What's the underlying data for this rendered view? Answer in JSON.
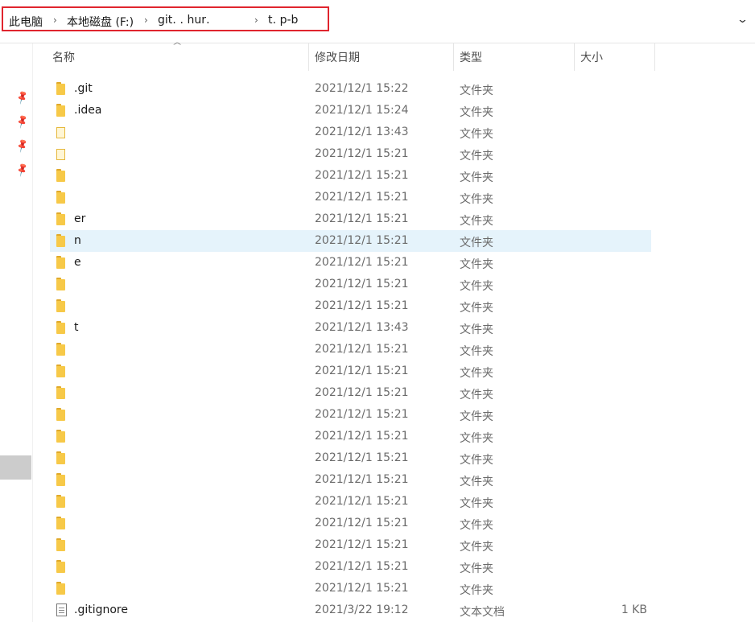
{
  "address_bar": {
    "crumbs": [
      "此电脑",
      "本地磁盘 (F:)",
      "git․ ․ hur․",
      "t․ p-b"
    ],
    "dropdown_icon": "chevron-down-icon",
    "highlight_color": "#e0252e"
  },
  "columns": {
    "name": "名称",
    "modified": "修改日期",
    "type": "类型",
    "size": "大小"
  },
  "files": [
    {
      "name": ".git",
      "modified": "2021/12/1 15:22",
      "type": "文件夹",
      "size": "",
      "icon": "folder-icon"
    },
    {
      "name": ".idea",
      "modified": "2021/12/1 15:24",
      "type": "文件夹",
      "size": "",
      "icon": "folder-icon"
    },
    {
      "name": "",
      "modified": "2021/12/1 13:43",
      "type": "文件夹",
      "size": "",
      "icon": "folder-open-icon"
    },
    {
      "name": "",
      "modified": "2021/12/1 15:21",
      "type": "文件夹",
      "size": "",
      "icon": "folder-open-icon"
    },
    {
      "name": "",
      "modified": "2021/12/1 15:21",
      "type": "文件夹",
      "size": "",
      "icon": "folder-icon"
    },
    {
      "name": "",
      "modified": "2021/12/1 15:21",
      "type": "文件夹",
      "size": "",
      "icon": "folder-icon"
    },
    {
      "name": "er",
      "modified": "2021/12/1 15:21",
      "type": "文件夹",
      "size": "",
      "icon": "folder-icon"
    },
    {
      "name": "n",
      "modified": "2021/12/1 15:21",
      "type": "文件夹",
      "size": "",
      "icon": "folder-icon",
      "selected": true
    },
    {
      "name": "e",
      "modified": "2021/12/1 15:21",
      "type": "文件夹",
      "size": "",
      "icon": "folder-icon"
    },
    {
      "name": "",
      "modified": "2021/12/1 15:21",
      "type": "文件夹",
      "size": "",
      "icon": "folder-icon"
    },
    {
      "name": "",
      "modified": "2021/12/1 15:21",
      "type": "文件夹",
      "size": "",
      "icon": "folder-icon"
    },
    {
      "name": "t",
      "modified": "2021/12/1 13:43",
      "type": "文件夹",
      "size": "",
      "icon": "folder-icon"
    },
    {
      "name": "",
      "modified": "2021/12/1 15:21",
      "type": "文件夹",
      "size": "",
      "icon": "folder-icon"
    },
    {
      "name": "",
      "modified": "2021/12/1 15:21",
      "type": "文件夹",
      "size": "",
      "icon": "folder-icon"
    },
    {
      "name": "",
      "modified": "2021/12/1 15:21",
      "type": "文件夹",
      "size": "",
      "icon": "folder-icon"
    },
    {
      "name": "",
      "modified": "2021/12/1 15:21",
      "type": "文件夹",
      "size": "",
      "icon": "folder-icon"
    },
    {
      "name": "",
      "modified": "2021/12/1 15:21",
      "type": "文件夹",
      "size": "",
      "icon": "folder-icon"
    },
    {
      "name": "",
      "modified": "2021/12/1 15:21",
      "type": "文件夹",
      "size": "",
      "icon": "folder-icon"
    },
    {
      "name": "",
      "modified": "2021/12/1 15:21",
      "type": "文件夹",
      "size": "",
      "icon": "folder-icon"
    },
    {
      "name": "",
      "modified": "2021/12/1 15:21",
      "type": "文件夹",
      "size": "",
      "icon": "folder-icon"
    },
    {
      "name": "",
      "modified": "2021/12/1 15:21",
      "type": "文件夹",
      "size": "",
      "icon": "folder-icon"
    },
    {
      "name": "",
      "modified": "2021/12/1 15:21",
      "type": "文件夹",
      "size": "",
      "icon": "folder-icon"
    },
    {
      "name": "",
      "modified": "2021/12/1 15:21",
      "type": "文件夹",
      "size": "",
      "icon": "folder-icon"
    },
    {
      "name": "",
      "modified": "2021/12/1 15:21",
      "type": "文件夹",
      "size": "",
      "icon": "folder-icon"
    },
    {
      "name": ".gitignore",
      "modified": "2021/3/22 19:12",
      "type": "文本文档",
      "size": "1 KB",
      "icon": "text-file-icon"
    }
  ],
  "nav": {
    "pin_icon": "pin-icon"
  }
}
